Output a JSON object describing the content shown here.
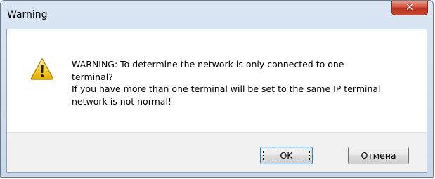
{
  "window": {
    "title": "Warning",
    "close_icon": "close-icon",
    "close_glyph": "✕"
  },
  "message": {
    "icon": "warning-icon",
    "lines": [
      "WARNING: To determine the network is only connected to one",
      "terminal?",
      "If you have more than one terminal will be set to the same IP terminal",
      "network is not normal!"
    ]
  },
  "buttons": {
    "ok_label": "OK",
    "cancel_label": "Отмена"
  },
  "colors": {
    "warning_yellow": "#f5c400",
    "close_red": "#c94a33",
    "focus_blue": "#3c7fb1"
  }
}
